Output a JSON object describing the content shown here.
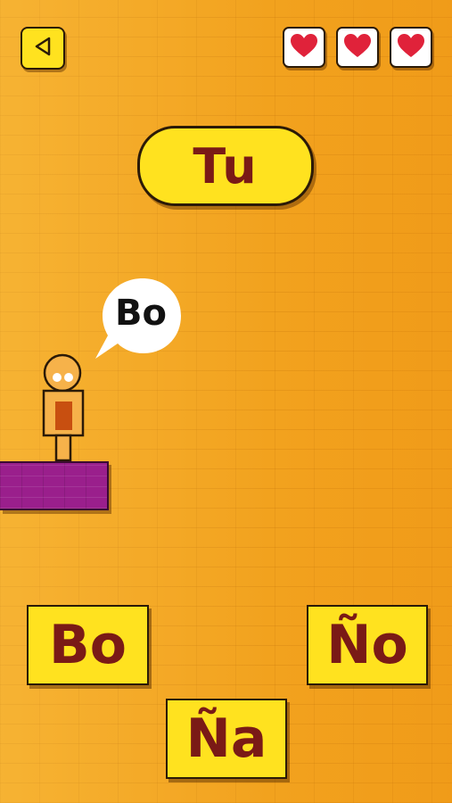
{
  "top_bar": {
    "back_icon": "triangle-left-icon",
    "lives": [
      {
        "icon": "heart-icon",
        "color": "#e0223a"
      },
      {
        "icon": "heart-icon",
        "color": "#e0223a"
      },
      {
        "icon": "heart-icon",
        "color": "#e0223a"
      }
    ]
  },
  "target_word": "Tu",
  "speech_bubble": "Bo",
  "options": [
    "Bo",
    "Ño",
    "Ña"
  ],
  "colors": {
    "background": "#f2a21e",
    "tile": "#ffe21f",
    "tile_text": "#7a1a16",
    "platform": "#9a1f8c"
  }
}
